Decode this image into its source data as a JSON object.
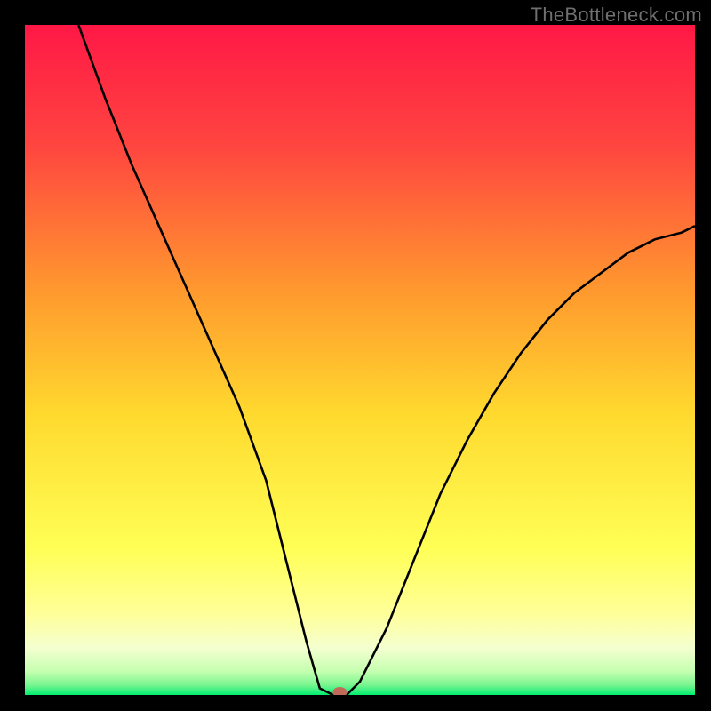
{
  "watermark": "TheBottleneck.com",
  "colors": {
    "background": "#000000",
    "gradient_top": "#ff1846",
    "gradient_upper_mid": "#ff7d2e",
    "gradient_mid": "#ffd92e",
    "gradient_lower_mid": "#ffff8f",
    "gradient_near_bottom": "#f6ffd0",
    "gradient_bottom": "#00ee70",
    "curve": "#000000",
    "dot": "#c26a5a"
  },
  "chart_data": {
    "type": "line",
    "title": "",
    "xlabel": "",
    "ylabel": "",
    "xlim": [
      0,
      100
    ],
    "ylim": [
      0,
      100
    ],
    "series": [
      {
        "name": "bottleneck-curve",
        "x": [
          8,
          12,
          16,
          20,
          24,
          28,
          32,
          36,
          38,
          40,
          42,
          44,
          46,
          48,
          50,
          54,
          58,
          62,
          66,
          70,
          74,
          78,
          82,
          86,
          90,
          94,
          98,
          100
        ],
        "values": [
          100,
          89,
          79,
          70,
          61,
          52,
          43,
          32,
          24,
          16,
          8,
          1,
          0,
          0,
          2,
          10,
          20,
          30,
          38,
          45,
          51,
          56,
          60,
          63,
          66,
          68,
          69,
          70
        ]
      }
    ],
    "marker": {
      "x": 47,
      "y": 0
    },
    "annotations": []
  }
}
